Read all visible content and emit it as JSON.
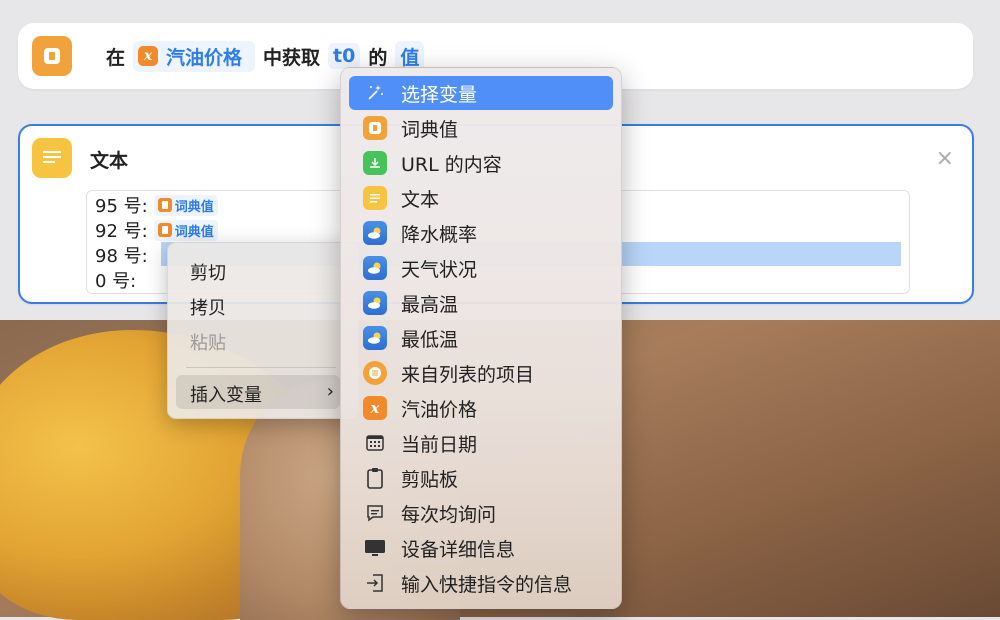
{
  "card1": {
    "prefix": "在",
    "variable": "汽油价格",
    "middle": "中获取",
    "key": "t0",
    "of": "的",
    "value_token": "值"
  },
  "card2": {
    "title": "文本",
    "close_glyph": "×",
    "lines": [
      {
        "label": "95 号:",
        "token": "词典值"
      },
      {
        "label": "92 号:",
        "token": "词典值"
      },
      {
        "label": "98 号:",
        "token": ""
      },
      {
        "label": "0 号:",
        "token": ""
      }
    ]
  },
  "context_menu": {
    "cut": "剪切",
    "copy": "拷贝",
    "paste": "粘贴",
    "insert_variable": "插入变量",
    "arrow": "›"
  },
  "submenu": {
    "items": [
      {
        "label": "选择变量",
        "icon": "magic-wand-icon"
      },
      {
        "label": "词典值",
        "icon": "dictionary-icon"
      },
      {
        "label": "URL 的内容",
        "icon": "download-icon"
      },
      {
        "label": "文本",
        "icon": "text-icon"
      },
      {
        "label": "降水概率",
        "icon": "weather-icon"
      },
      {
        "label": "天气状况",
        "icon": "weather-icon"
      },
      {
        "label": "最高温",
        "icon": "weather-icon"
      },
      {
        "label": "最低温",
        "icon": "weather-icon"
      },
      {
        "label": "来自列表的项目",
        "icon": "list-icon"
      },
      {
        "label": "汽油价格",
        "icon": "variable-icon"
      },
      {
        "label": "当前日期",
        "icon": "calendar-icon"
      },
      {
        "label": "剪贴板",
        "icon": "clipboard-icon"
      },
      {
        "label": "每次均询问",
        "icon": "ask-icon"
      },
      {
        "label": "设备详细信息",
        "icon": "monitor-icon"
      },
      {
        "label": "输入快捷指令的信息",
        "icon": "input-icon"
      }
    ]
  },
  "colors": {
    "accent": "#3a7de3",
    "highlight": "#4f8ff7",
    "token_text": "#2f7de6",
    "orange": "#f2a23a",
    "yellow": "#f6c441",
    "green": "#48c25a"
  }
}
